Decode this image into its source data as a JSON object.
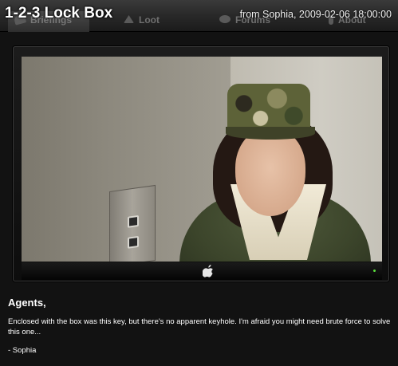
{
  "header": {
    "title": "1-2-3 Lock Box",
    "meta": "from Sophia, 2009-02-06 18:00:00",
    "tabs": [
      {
        "label": "Briefings",
        "icon": "helmet-icon"
      },
      {
        "label": "Loot",
        "icon": "loot-icon"
      },
      {
        "label": "Forums",
        "icon": "speech-bubble-icon"
      },
      {
        "label": "About",
        "icon": "info-icon"
      }
    ]
  },
  "video": {
    "controller_icon": "apple-icon",
    "led_color": "#5adf3c"
  },
  "message": {
    "greeting": "Agents,",
    "body": "Enclosed with the box was this key, but there's no apparent keyhole. I'm afraid you might need brute force to solve this one...",
    "signature": "- Sophia"
  }
}
